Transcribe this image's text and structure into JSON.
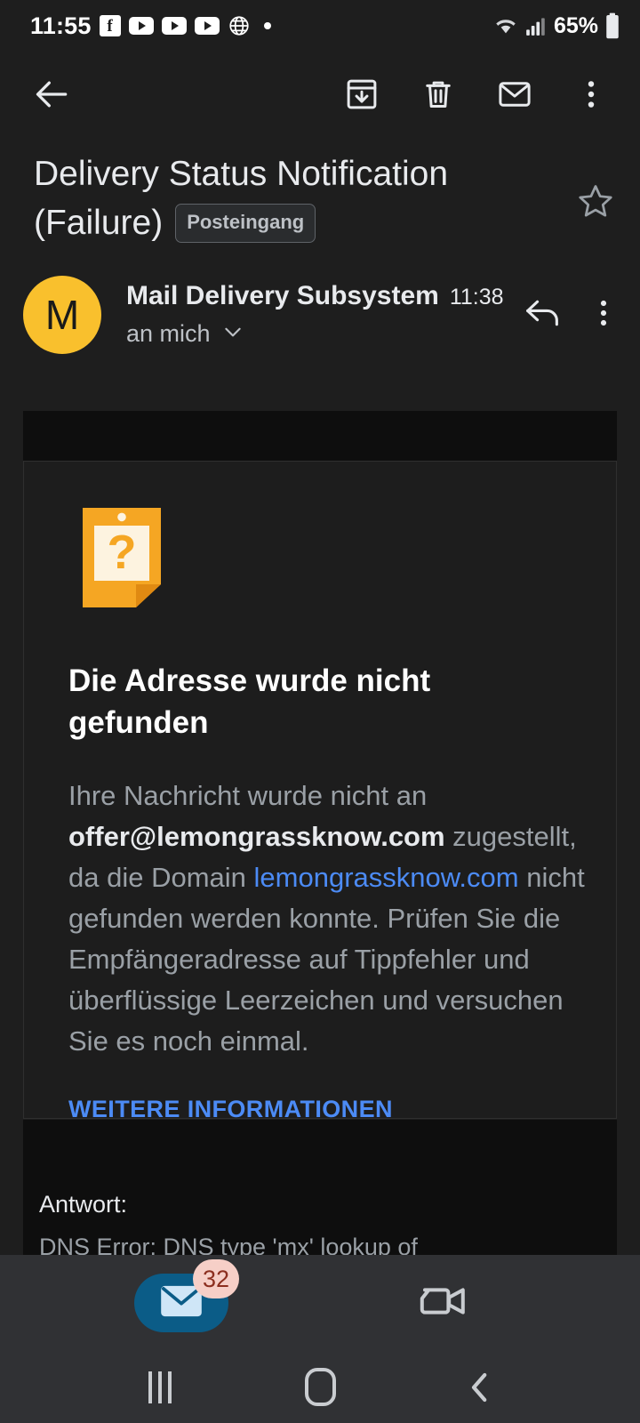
{
  "status_bar": {
    "time": "11:55",
    "icons": [
      "facebook-icon",
      "youtube-icon",
      "youtube-icon",
      "youtube-icon",
      "globe-icon",
      "dot-icon"
    ],
    "battery_percent": "65%",
    "wifi": "wifi-icon",
    "signal": "signal-icon"
  },
  "toolbar": {
    "back": "back-arrow-icon",
    "archive": "archive-icon",
    "delete": "trash-icon",
    "mark_unread": "mail-icon",
    "more": "more-vertical-icon"
  },
  "email": {
    "subject": "Delivery Status Notification (Failure)",
    "label": "Posteingang",
    "starred": false,
    "sender_initial": "M",
    "sender_name": "Mail Delivery Subsystem",
    "time": "11:38",
    "recipient": "an mich",
    "reply_icon": "reply-arrow-icon",
    "more_icon": "more-vertical-icon"
  },
  "notice": {
    "icon": "question-note-icon",
    "heading": "Die Adresse wurde nicht gefunden",
    "body_part1": "Ihre Nachricht wurde nicht an ",
    "body_address": "offer@lemongrassknow.com",
    "body_part2": " zugestellt, da die Domain ",
    "body_domain": "lemongrassknow.com",
    "body_part3": " nicht gefunden werden konnte. Prüfen Sie die Empfängeradresse auf Tippfehler und überflüssige Leerzeichen und versuchen Sie es noch einmal.",
    "more_info_link": "WEITERE INFORMATIONEN"
  },
  "reply_section": {
    "label": "Antwort:",
    "cut_off_text": "DNS Error: DNS type 'mx' lookup of"
  },
  "bottom_nav": {
    "mail_label": "mail-icon",
    "mail_badge": "32",
    "meet_label": "video-camera-icon"
  },
  "system_nav": {
    "recents": "recents-icon",
    "home": "home-icon",
    "back": "back-chevron-icon"
  },
  "colors": {
    "accent_blue": "#4c8bf5",
    "avatar_yellow": "#f9c02d",
    "nav_pill_blue": "#0b5c87",
    "badge_pink": "#f6cfc7",
    "notice_orange": "#f5a623"
  }
}
